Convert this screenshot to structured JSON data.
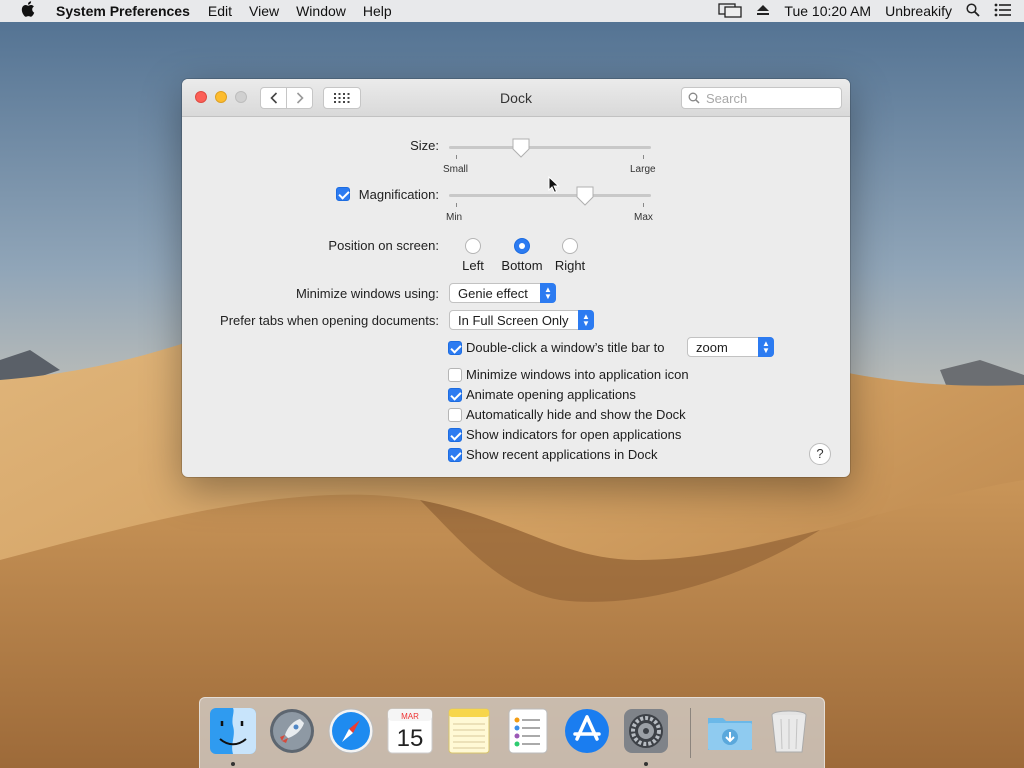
{
  "menubar": {
    "app_name": "System Preferences",
    "menus": [
      "Edit",
      "View",
      "Window",
      "Help"
    ],
    "clock": "Tue 10:20 AM",
    "user": "Unbreakify"
  },
  "window": {
    "title": "Dock",
    "search_placeholder": "Search"
  },
  "size": {
    "label": "Size:",
    "min_label": "Small",
    "max_label": "Large",
    "value": 0.35
  },
  "magnification": {
    "label": "Magnification:",
    "checked": true,
    "min_label": "Min",
    "max_label": "Max",
    "value": 0.69
  },
  "position": {
    "label": "Position on screen:",
    "options": [
      "Left",
      "Bottom",
      "Right"
    ],
    "selected": "Bottom"
  },
  "minimize": {
    "label": "Minimize windows using:",
    "value": "Genie effect"
  },
  "prefer_tabs": {
    "label": "Prefer tabs when opening documents:",
    "value": "In Full Screen Only"
  },
  "double_click": {
    "label": "Double-click a window’s title bar to",
    "checked": true,
    "value": "zoom"
  },
  "options": [
    {
      "label": "Minimize windows into application icon",
      "checked": false
    },
    {
      "label": "Animate opening applications",
      "checked": true
    },
    {
      "label": "Automatically hide and show the Dock",
      "checked": false
    },
    {
      "label": "Show indicators for open applications",
      "checked": true
    },
    {
      "label": "Show recent applications in Dock",
      "checked": true
    }
  ],
  "help_label": "?",
  "dock": {
    "calendar_month": "MAR",
    "calendar_day": "15",
    "apps": [
      "finder",
      "launchpad",
      "safari",
      "calendar",
      "notes",
      "reminders",
      "app-store",
      "system-preferences"
    ],
    "running": [
      "finder",
      "system-preferences"
    ],
    "extras": [
      "downloads",
      "trash"
    ]
  }
}
